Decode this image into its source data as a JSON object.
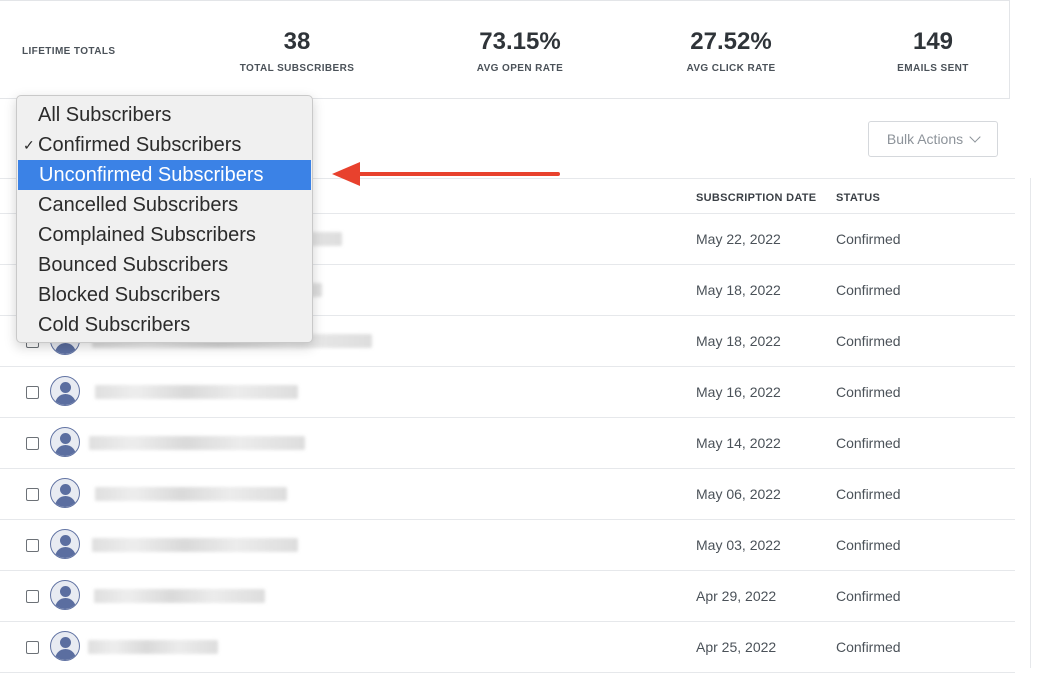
{
  "stats": {
    "label": "LIFETIME TOTALS",
    "items": [
      {
        "value": "38",
        "label": "TOTAL SUBSCRIBERS"
      },
      {
        "value": "73.15%",
        "label": "AVG OPEN RATE"
      },
      {
        "value": "27.52%",
        "label": "AVG CLICK RATE"
      },
      {
        "value": "149",
        "label": "EMAILS SENT"
      }
    ]
  },
  "toolbar": {
    "bulk_actions": "Bulk Actions"
  },
  "filter_dropdown": {
    "options": [
      "All Subscribers",
      "Confirmed Subscribers",
      "Unconfirmed Subscribers",
      "Cancelled Subscribers",
      "Complained Subscribers",
      "Bounced Subscribers",
      "Blocked Subscribers",
      "Cold Subscribers"
    ],
    "checked": "Confirmed Subscribers",
    "highlighted": "Unconfirmed Subscribers",
    "check_mark": "✓"
  },
  "table": {
    "headers": {
      "date": "SUBSCRIPTION DATE",
      "status": "STATUS"
    },
    "rows": [
      {
        "date": "May 22, 2022",
        "status": "Confirmed"
      },
      {
        "date": "May 18, 2022",
        "status": "Confirmed"
      },
      {
        "date": "May 18, 2022",
        "status": "Confirmed"
      },
      {
        "date": "May 16, 2022",
        "status": "Confirmed"
      },
      {
        "date": "May 14, 2022",
        "status": "Confirmed"
      },
      {
        "date": "May 06, 2022",
        "status": "Confirmed"
      },
      {
        "date": "May 03, 2022",
        "status": "Confirmed"
      },
      {
        "date": "Apr 29, 2022",
        "status": "Confirmed"
      },
      {
        "date": "Apr 25, 2022",
        "status": "Confirmed"
      }
    ]
  },
  "colors": {
    "highlight": "#3b82e6",
    "arrow": "#e8412d",
    "avatar": "#5b6ea0"
  }
}
